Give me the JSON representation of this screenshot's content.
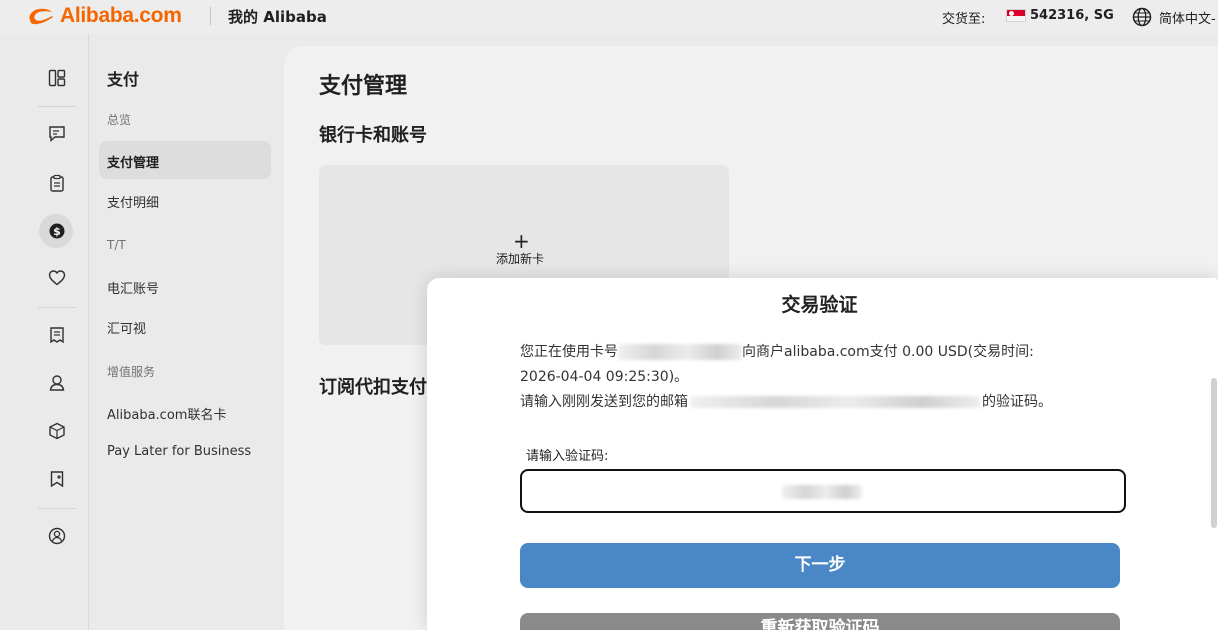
{
  "header": {
    "logo_text": "Alibaba.com",
    "title": "我的 Alibaba",
    "ship_to_label": "交货至:",
    "ship_to_value": "542316, SG",
    "language": "简体中文-"
  },
  "subnav": {
    "title": "支付",
    "groups": [
      {
        "label": "总览"
      },
      {
        "label": "T/T"
      },
      {
        "label": "增值服务"
      }
    ],
    "items": [
      {
        "label": "支付管理"
      },
      {
        "label": "支付明细"
      },
      {
        "label": "电汇账号"
      },
      {
        "label": "汇可视"
      },
      {
        "label": "Alibaba.com联名卡"
      },
      {
        "label": "Pay Later for Business"
      }
    ]
  },
  "rail_icons": [
    "dashboard-icon",
    "ai-chat-icon",
    "clipboard-icon",
    "payment-icon",
    "heart-icon",
    "document-icon",
    "service-icon",
    "package-icon",
    "bookmark-icon",
    "account-icon"
  ],
  "main": {
    "page_title": "支付管理",
    "section_bank": "银行卡和账号",
    "add_card_plus": "+",
    "add_card_label": "添加新卡",
    "section_subscription": "订阅代扣支付"
  },
  "modal": {
    "title": "交易验证",
    "line1_prefix": "您正在使用卡号",
    "line1_suffix": "向商户alibaba.com支付 0.00 USD(交易时间:",
    "line2": "2026-04-04 09:25:30)。",
    "line3_prefix": "请输入刚刚发送到您的邮箱",
    "line3_suffix": "的验证码。",
    "code_label": "请输入验证码:",
    "next_button": "下一步",
    "resend_button": "重新获取验证码"
  },
  "colors": {
    "brand": "#ff6a00",
    "primary_button": "#4a87c6",
    "secondary_button": "#8a8a8a"
  }
}
